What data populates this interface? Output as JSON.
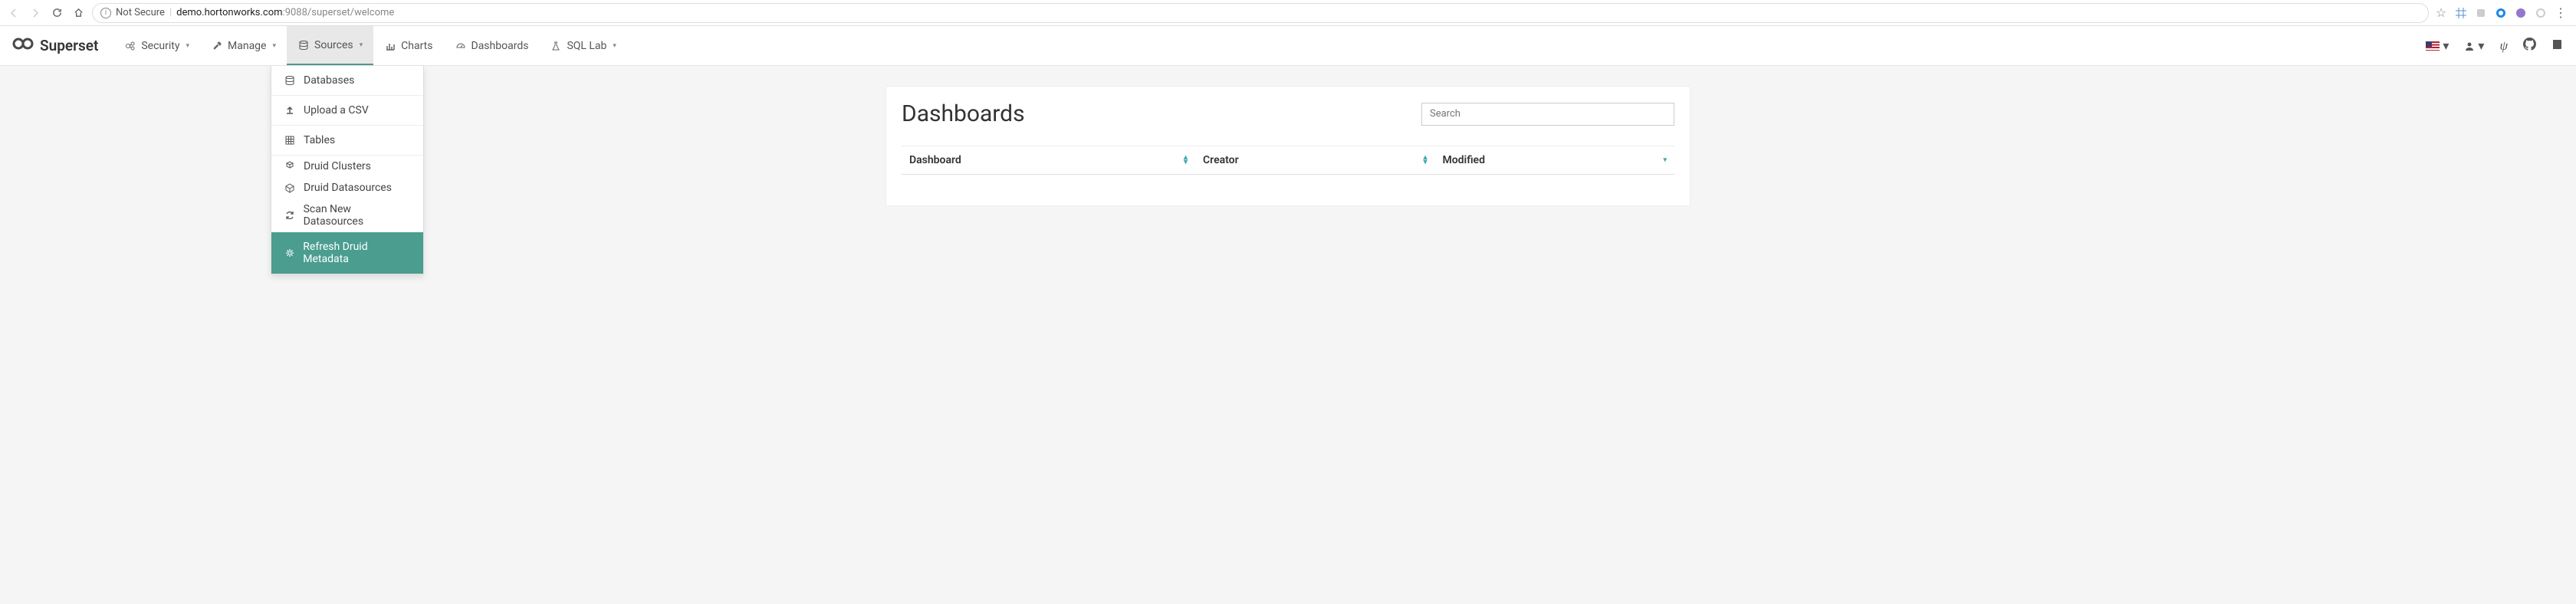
{
  "browser": {
    "not_secure": "Not Secure",
    "host": "demo.hortonworks.com",
    "port": ":9088",
    "path": "/superset/welcome"
  },
  "brand": "Superset",
  "nav": {
    "security": "Security",
    "manage": "Manage",
    "sources": "Sources",
    "charts": "Charts",
    "dashboards": "Dashboards",
    "sqllab": "SQL Lab"
  },
  "dropdown": {
    "databases": "Databases",
    "upload_csv": "Upload a CSV",
    "tables": "Tables",
    "druid_clusters": "Druid Clusters",
    "druid_datasources": "Druid Datasources",
    "scan_new": "Scan New Datasources",
    "refresh_druid": "Refresh Druid Metadata"
  },
  "page": {
    "title": "Dashboards",
    "search_placeholder": "Search"
  },
  "table": {
    "col1": "Dashboard",
    "col2": "Creator",
    "col3": "Modified"
  }
}
